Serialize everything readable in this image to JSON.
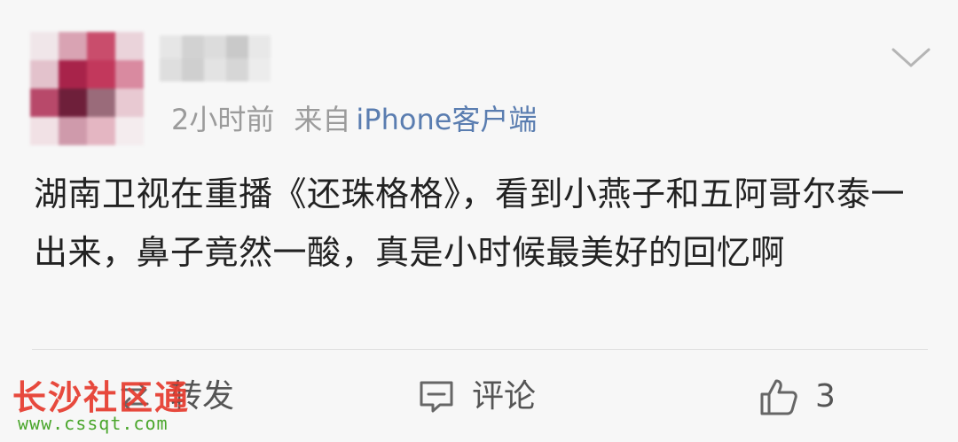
{
  "post": {
    "time": "2小时前",
    "from_label": "来自",
    "source": "iPhone客户端",
    "text": "湖南卫视在重播《还珠格格》，看到小燕子和五阿哥尔泰一出来，鼻子竟然一酸，真是小时候最美好的回忆啊"
  },
  "actions": {
    "repost_label": "转发",
    "comment_label": "评论",
    "like_count": "3"
  },
  "watermark": {
    "title": "长沙社区通",
    "url": "www.cssqt.com"
  },
  "colors": {
    "background": "#f7f7f7",
    "source_link": "#5a7db0",
    "meta_gray": "#9b9b9b",
    "watermark_red": "#e63b2e",
    "watermark_green": "#4aa62c"
  },
  "icons": [
    "chevron-down-icon",
    "repost-icon",
    "comment-icon",
    "thumbs-up-icon"
  ]
}
